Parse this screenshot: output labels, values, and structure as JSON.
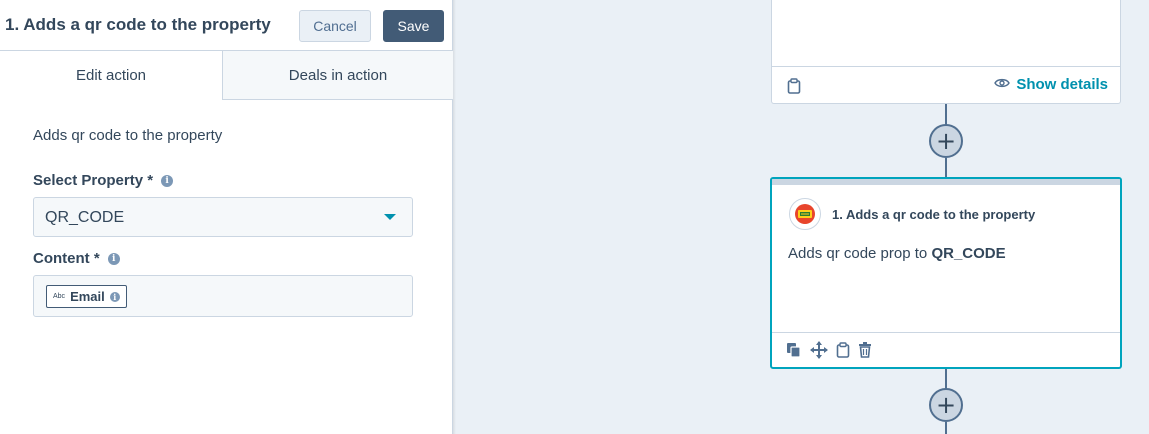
{
  "panel": {
    "title": "1. Adds a qr code to the property",
    "cancel_label": "Cancel",
    "save_label": "Save",
    "tabs": [
      {
        "label": "Edit action",
        "active": true
      },
      {
        "label": "Deals in action",
        "active": false
      }
    ],
    "description": "Adds qr code to the property",
    "select_property": {
      "label": "Select Property *",
      "value": "QR_CODE"
    },
    "content": {
      "label": "Content *",
      "token": {
        "type": "Abc",
        "label": "Email"
      }
    }
  },
  "canvas": {
    "previous_card": {
      "show_details_label": "Show details"
    },
    "action_card": {
      "title": "1. Adds a qr code to the property",
      "description_prefix": "Adds qr code prop to",
      "description_value": "QR_CODE"
    },
    "add_step_icon": "plus-icon"
  },
  "colors": {
    "accent": "#0091ae",
    "primary_button": "#425b76",
    "selected_border": "#00a4bd",
    "canvas_bg": "#eaf0f6"
  }
}
